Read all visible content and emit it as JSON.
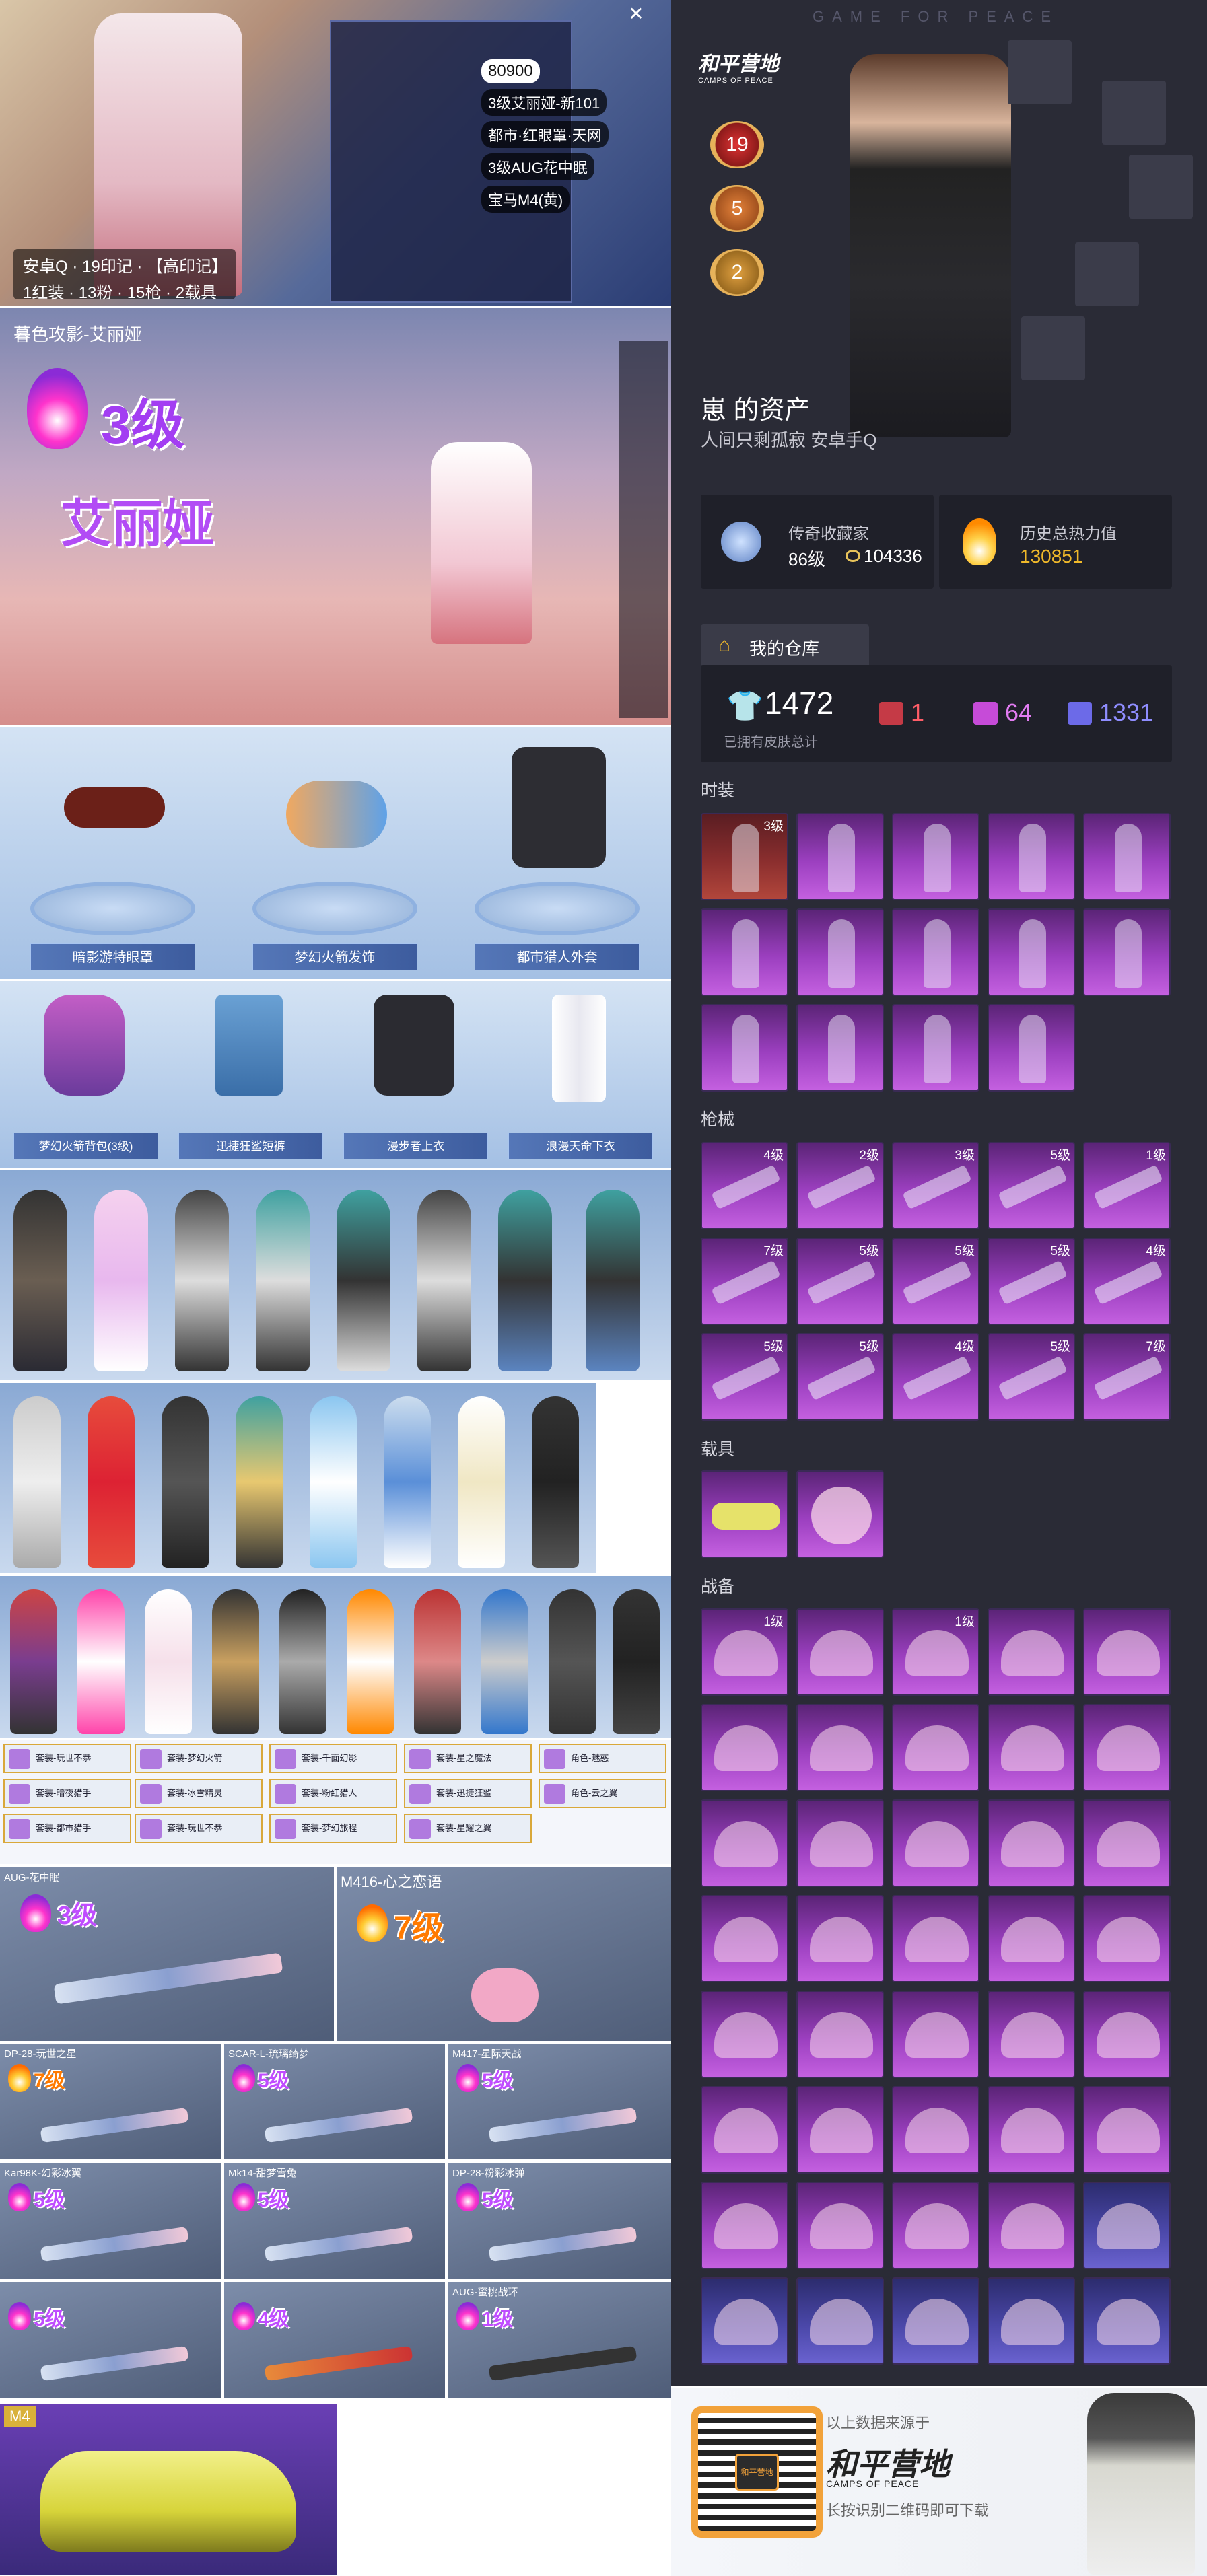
{
  "promo": {
    "lobby_badges": [
      "80900",
      "3级艾丽娅-新101",
      "都市·红眼罩·天网",
      "3级AUG花中眠",
      "宝马M4(黄)"
    ],
    "lobby_caption_line1": "安卓Q · 19印记 · 【高印记】",
    "lobby_caption_line2": "1红装 · 13粉 · 15枪 · 2载具",
    "level_outfit_title": "暮色攻影-艾丽娅",
    "level_outfit_level": "3级",
    "level_outfit_name": "艾丽娅",
    "items_row1": [
      "暗影游特眼罩",
      "梦幻火箭发饰",
      "都市猎人外套"
    ],
    "items_row2": [
      "梦幻火箭背包(3级)",
      "迅捷狂鲨短裤",
      "漫步者上衣",
      "浪漫天命下衣"
    ],
    "gun_big": [
      {
        "name": "AUG-花中眠",
        "level": "3级"
      },
      {
        "name": "M416-心之恋语",
        "level": "7级"
      }
    ],
    "gun_small": [
      {
        "name": "DP-28-玩世之星",
        "level": "7级"
      },
      {
        "name": "SCAR-L-琉璃绮梦",
        "level": "5级"
      },
      {
        "name": "M417-星际天战",
        "level": "5级"
      },
      {
        "name": "Kar98K-幻彩冰翼",
        "level": "5级"
      },
      {
        "name": "Mk14-甜梦雪兔",
        "level": "5级"
      },
      {
        "name": "DP-28-粉彩冰弹",
        "level": "5级"
      },
      {
        "name": "",
        "level": "5级"
      },
      {
        "name": "",
        "level": "4级"
      },
      {
        "name": "AUG-蜜桃战环",
        "level": "1级"
      }
    ],
    "tags": [
      "套装-玩世不恭",
      "套装-梦幻火箭",
      "套装-千面幻影",
      "套装-星之魔法",
      "角色-魅惑",
      "套装-暗夜猎手",
      "套装-冰雪精灵",
      "套装-粉红猎人",
      "套装-迅捷狂鲨",
      "角色-云之翼",
      "套装-都市猎手",
      "套装-玩世不恭",
      "套装-梦幻旅程",
      "套装-星耀之翼"
    ],
    "car_tag": "M4"
  },
  "profile": {
    "brand": "和平营地",
    "brand_sub": "CAMPS OF PEACE",
    "watermark": "GAME FOR PEACE",
    "badges": [
      "19",
      "5",
      "2"
    ],
    "name": "崽 的资产",
    "subtitle": "人间只剩孤寂  安卓手Q",
    "collector_title": "传奇收藏家",
    "collector_level": "86级",
    "collector_points": "104336",
    "heat_title": "历史总热力值",
    "heat_value": "130851"
  },
  "warehouse": {
    "title": "我的仓库",
    "total": "1472",
    "total_label": "已拥有皮肤总计",
    "red_count": "1",
    "pink_count": "64",
    "blue_count": "1331"
  },
  "sections": {
    "fashion": "时装",
    "guns": "枪械",
    "vehicles": "载具",
    "gear": "战备"
  },
  "fashion_tiles": [
    {
      "r": "r",
      "lv": "3级"
    },
    {
      "r": "p",
      "lv": ""
    },
    {
      "r": "p",
      "lv": ""
    },
    {
      "r": "p",
      "lv": ""
    },
    {
      "r": "p",
      "lv": ""
    },
    {
      "r": "p",
      "lv": ""
    },
    {
      "r": "p",
      "lv": ""
    },
    {
      "r": "p",
      "lv": ""
    },
    {
      "r": "p",
      "lv": ""
    },
    {
      "r": "p",
      "lv": ""
    },
    {
      "r": "p",
      "lv": ""
    },
    {
      "r": "p",
      "lv": ""
    },
    {
      "r": "p",
      "lv": ""
    },
    {
      "r": "p",
      "lv": ""
    }
  ],
  "gun_tiles": [
    "4级",
    "2级",
    "3级",
    "5级",
    "1级",
    "7级",
    "5级",
    "5级",
    "5级",
    "4级",
    "5级",
    "5级",
    "4级",
    "5级",
    "7级"
  ],
  "gear_tiles": [
    {
      "r": "p",
      "lv": "1级"
    },
    {
      "r": "p",
      "lv": ""
    },
    {
      "r": "p",
      "lv": "1级"
    },
    {
      "r": "p",
      "lv": ""
    },
    {
      "r": "p",
      "lv": ""
    },
    {
      "r": "p",
      "lv": ""
    },
    {
      "r": "p",
      "lv": ""
    },
    {
      "r": "p",
      "lv": ""
    },
    {
      "r": "p",
      "lv": ""
    },
    {
      "r": "p",
      "lv": ""
    },
    {
      "r": "p",
      "lv": ""
    },
    {
      "r": "p",
      "lv": ""
    },
    {
      "r": "p",
      "lv": ""
    },
    {
      "r": "p",
      "lv": ""
    },
    {
      "r": "p",
      "lv": ""
    },
    {
      "r": "p",
      "lv": ""
    },
    {
      "r": "p",
      "lv": ""
    },
    {
      "r": "p",
      "lv": ""
    },
    {
      "r": "p",
      "lv": ""
    },
    {
      "r": "p",
      "lv": ""
    },
    {
      "r": "p",
      "lv": ""
    },
    {
      "r": "p",
      "lv": ""
    },
    {
      "r": "p",
      "lv": ""
    },
    {
      "r": "p",
      "lv": ""
    },
    {
      "r": "p",
      "lv": ""
    },
    {
      "r": "p",
      "lv": ""
    },
    {
      "r": "p",
      "lv": ""
    },
    {
      "r": "p",
      "lv": ""
    },
    {
      "r": "p",
      "lv": ""
    },
    {
      "r": "p",
      "lv": ""
    },
    {
      "r": "p",
      "lv": ""
    },
    {
      "r": "p",
      "lv": ""
    },
    {
      "r": "p",
      "lv": ""
    },
    {
      "r": "p",
      "lv": ""
    },
    {
      "r": "b",
      "lv": ""
    },
    {
      "r": "b",
      "lv": ""
    },
    {
      "r": "b",
      "lv": ""
    },
    {
      "r": "b",
      "lv": ""
    },
    {
      "r": "b",
      "lv": ""
    },
    {
      "r": "b",
      "lv": ""
    }
  ],
  "footer": {
    "source_label": "以上数据来源于",
    "brand": "和平营地",
    "brand_sub": "CAMPS OF PEACE",
    "hint": "长按识别二维码即可下载",
    "qr_label": "和平营地"
  }
}
